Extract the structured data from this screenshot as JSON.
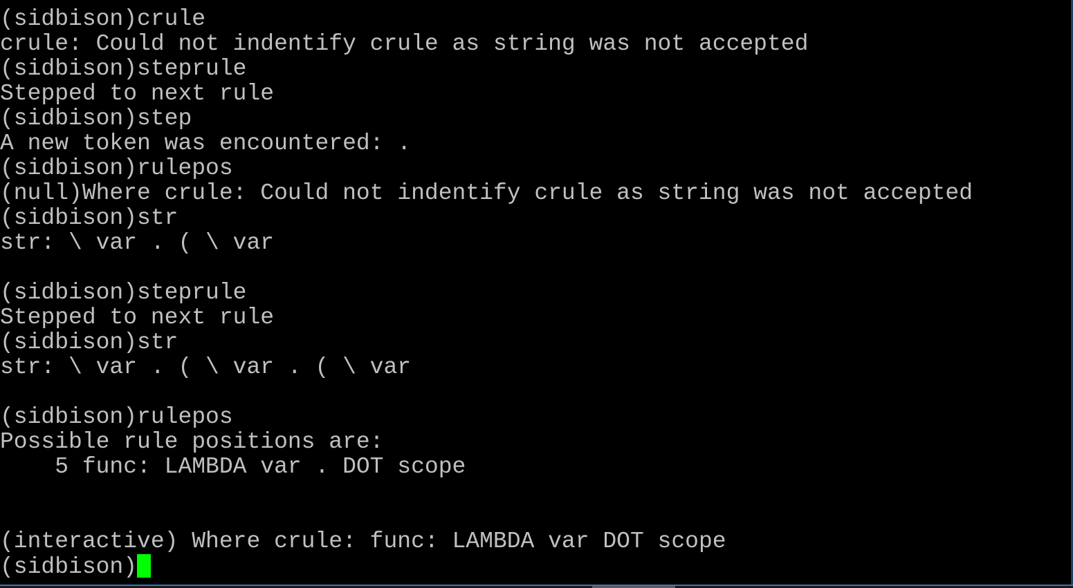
{
  "terminal": {
    "lines": [
      "(sidbison)crule",
      "crule: Could not indentify crule as string was not accepted",
      "(sidbison)steprule",
      "Stepped to next rule",
      "(sidbison)step",
      "A new token was encountered: .",
      "(sidbison)rulepos",
      "(null)Where crule: Could not indentify crule as string was not accepted",
      "(sidbison)str",
      "str: \\ var . ( \\ var",
      "",
      "(sidbison)steprule",
      "Stepped to next rule",
      "(sidbison)str",
      "str: \\ var . ( \\ var . ( \\ var",
      "",
      "(sidbison)rulepos",
      "Possible rule positions are:",
      "    5 func: LAMBDA var . DOT scope",
      "",
      "",
      "(interactive) Where crule: func: LAMBDA var DOT scope"
    ],
    "prompt": "(sidbison)",
    "cursor_color": "#00ff00",
    "text_color": "#c0c0c0",
    "background_color": "#000000"
  }
}
